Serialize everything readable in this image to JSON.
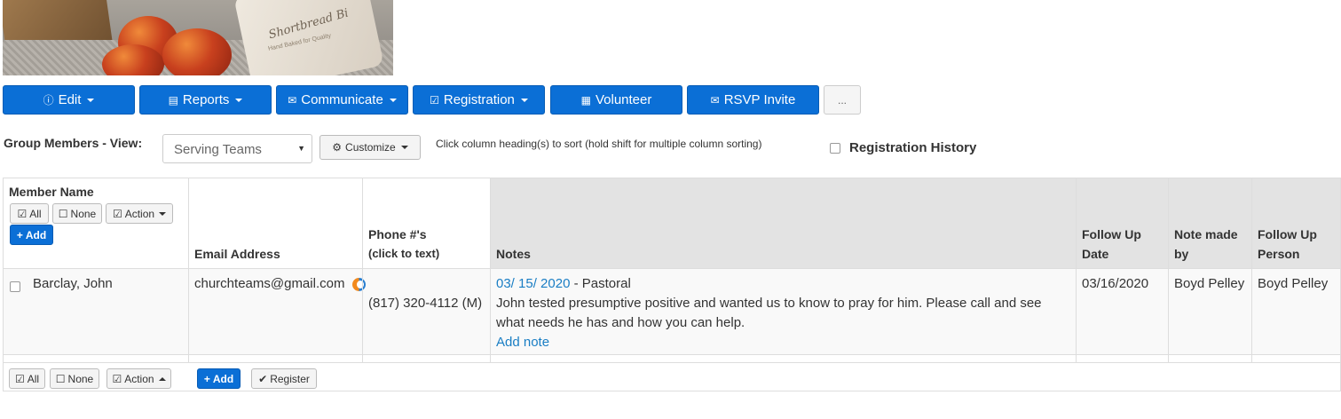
{
  "toolbar": {
    "edit": "Edit",
    "reports": "Reports",
    "communicate": "Communicate",
    "registration": "Registration",
    "volunteer": "Volunteer",
    "rsvp": "RSVP Invite",
    "more": "..."
  },
  "hero": {
    "label": "Shortbread Bi",
    "sub": "Hand Baked for Quality"
  },
  "viewbar": {
    "label": "Group Members - View:",
    "view_value": "Serving Teams",
    "customize": "Customize",
    "hint": "Click column heading(s) to sort (hold shift for multiple column sorting)",
    "registration_history": "Registration History"
  },
  "table": {
    "headers": {
      "member_name": "Member Name",
      "email": "Email Address",
      "phone": "Phone #'s",
      "phone_sub": "(click to text)",
      "notes": "Notes",
      "follow_up_date_1": "Follow Up",
      "follow_up_date_2": "Date",
      "note_made_by_1": "Note made",
      "note_made_by_2": "by",
      "follow_up_person_1": "Follow Up",
      "follow_up_person_2": "Person"
    },
    "header_buttons": {
      "all": "All",
      "none": "None",
      "action": "Action",
      "add": "Add"
    },
    "rows": [
      {
        "name": "Barclay, John",
        "email": "churchteams@gmail.com",
        "phone": "(817) 320-4112 (M)",
        "note_date": "03/ 15/ 2020",
        "note_type": " - Pastoral",
        "note_line1": "John tested presumptive positive and wanted us to know to pray for him. Please call and see",
        "note_line2": "what needs he has and how you can help.",
        "add_note": "Add note",
        "follow_up_date": "03/16/2020",
        "note_made_by": "Boyd Pelley",
        "follow_up_person": "Boyd Pelley"
      }
    ],
    "footer_buttons": {
      "all": "All",
      "none": "None",
      "action": "Action",
      "add": "Add",
      "register": "Register"
    }
  },
  "colors": {
    "primary": "#0b6fd6",
    "link": "#1a7ec4",
    "header_bg": "#e3e3e3"
  }
}
